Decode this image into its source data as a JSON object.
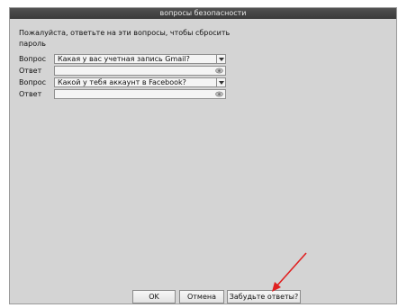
{
  "dialog": {
    "title": "вопросы безопасности",
    "intro": "Пожалуйста, ответьте на эти вопросы, чтобы сбросить пароль"
  },
  "rows": {
    "q1_label": "Вопрос",
    "q1_value": "Какая у вас учетная запись Gmail?",
    "a1_label": "Ответ",
    "q2_label": "Вопрос",
    "q2_value": "Какой у тебя аккаунт в Facebook?",
    "a2_label": "Ответ"
  },
  "buttons": {
    "ok": "OK",
    "cancel": "Отмена",
    "forgot": "Забудьте ответы?"
  },
  "colors": {
    "titlebar": "#3a3a3a",
    "dialog_bg": "#d4d4d4",
    "annotation_arrow": "#e02020"
  },
  "icons": {
    "dropdown": "chevron-down-icon",
    "password": "eye-icon"
  }
}
